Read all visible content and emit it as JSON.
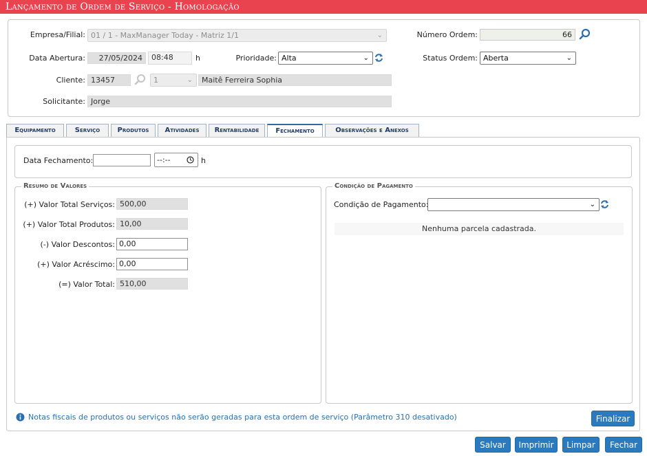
{
  "window": {
    "title": "Lançamento de Ordem de Serviço  - Homologação"
  },
  "header": {
    "empresa_label": "Empresa/Filial:",
    "empresa_value": "01 / 1 - MaxManager Today - Matriz 1/1",
    "numero_label": "Número Ordem:",
    "numero_value": "66",
    "data_abertura_label": "Data Abertura:",
    "data_abertura_date": "27/05/2024",
    "data_abertura_time": "08:48",
    "hour_suffix": "h",
    "prioridade_label": "Prioridade:",
    "prioridade_value": "Alta",
    "status_label": "Status Ordem:",
    "status_value": "Aberta",
    "cliente_label": "Cliente:",
    "cliente_code": "13457",
    "cliente_seq": "1",
    "cliente_name": "Maitê Ferreira Sophia",
    "solicitante_label": "Solicitante:",
    "solicitante_value": "Jorge"
  },
  "tabs": [
    {
      "label": "Equipamento"
    },
    {
      "label": "Serviço"
    },
    {
      "label": "Produtos"
    },
    {
      "label": "Atividades"
    },
    {
      "label": "Rentabilidade"
    },
    {
      "label": "Fechamento",
      "active": true
    },
    {
      "label": "Observações e Anexos"
    }
  ],
  "fechamento": {
    "data_label": "Data Fechamento:",
    "data_value": "",
    "time_placeholder": "--:--",
    "hour_suffix": "h"
  },
  "resumo": {
    "title": "Resumo de Valores",
    "rows": [
      {
        "label": "(+) Valor Total Serviços:",
        "value": "500,00",
        "editable": false
      },
      {
        "label": "(+) Valor Total Produtos:",
        "value": "10,00",
        "editable": false
      },
      {
        "label": "(-) Valor Descontos:",
        "value": "0,00",
        "editable": true
      },
      {
        "label": "(+) Valor Acréscimo:",
        "value": "0,00",
        "editable": true
      },
      {
        "label": "(=) Valor Total:",
        "value": "510,00",
        "editable": false
      }
    ]
  },
  "pagamento": {
    "title": "Condição de Pagamento",
    "label": "Condição de Pagamento:",
    "value": "",
    "empty_message": "Nenhuma parcela cadastrada."
  },
  "info_note": "Notas fiscais de produtos ou serviços não serão geradas para esta ordem de serviço (Parâmetro 310 desativado)",
  "buttons": {
    "finalizar": "Finalizar",
    "salvar": "Salvar",
    "imprimir": "Imprimir",
    "limpar": "Limpar",
    "fechar": "Fechar"
  },
  "colors": {
    "title_bar": "#e8434f",
    "button": "#2a7abf",
    "tab_text": "#1f3b66",
    "info_text": "#2a6fb0"
  }
}
